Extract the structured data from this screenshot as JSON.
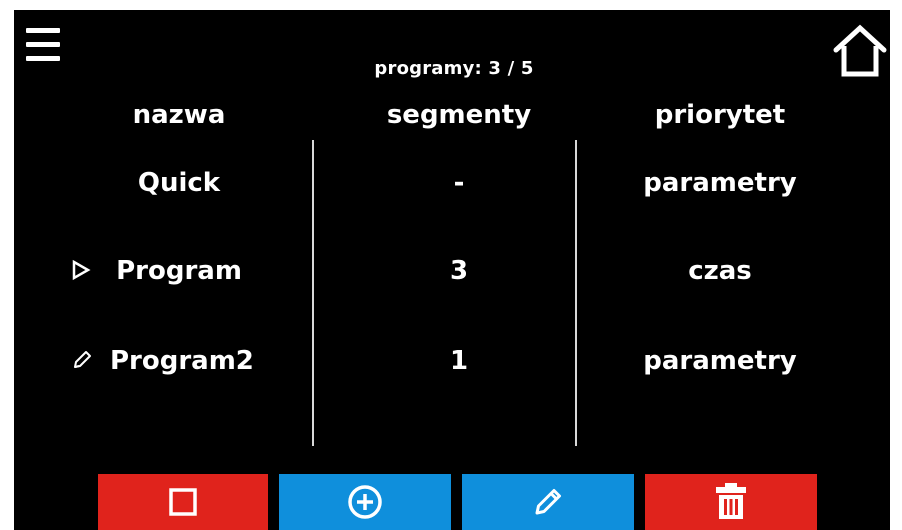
{
  "header": {
    "counter_text": "programy: 3 / 5",
    "menu_icon": "hamburger-menu-icon",
    "home_icon": "home-icon"
  },
  "columns": {
    "name": "nazwa",
    "segments": "segmenty",
    "priority": "priorytet"
  },
  "programs": [
    {
      "name": "Quick",
      "segments": "-",
      "priority": "parametry",
      "status_icon": ""
    },
    {
      "name": "Program",
      "segments": "3",
      "priority": "czas",
      "status_icon": "play-outline-icon"
    },
    {
      "name": "Program2",
      "segments": "1",
      "priority": "parametry",
      "status_icon": "pencil-icon"
    }
  ],
  "toolbar": [
    {
      "action": "stop",
      "icon": "stop-square-icon",
      "color": "#e0231c"
    },
    {
      "action": "add",
      "icon": "add-circle-icon",
      "color": "#0f8fdc"
    },
    {
      "action": "edit",
      "icon": "pencil-icon",
      "color": "#0f8fdc"
    },
    {
      "action": "delete",
      "icon": "trash-icon",
      "color": "#e0231c"
    }
  ],
  "colors": {
    "background": "#000000",
    "text": "#ffffff",
    "divider": "#d8d8d8"
  }
}
